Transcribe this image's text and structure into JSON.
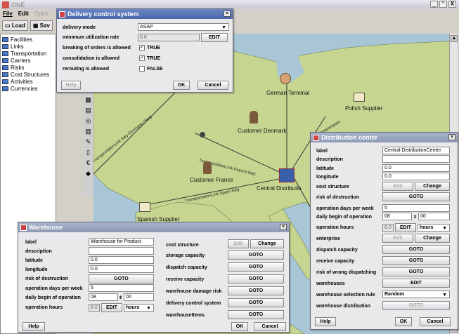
{
  "app": {
    "title": "ONE",
    "menu": [
      "File",
      "Edit",
      "Optio"
    ],
    "toolbar": {
      "load": "Load",
      "save": "Sav"
    },
    "window_controls": [
      "_",
      "°",
      "X"
    ]
  },
  "tree": {
    "items": [
      "Facilities",
      "Links",
      "Transportation",
      "Carriers",
      "Risks",
      "Cost Structures",
      "Activities",
      "Currencies"
    ]
  },
  "map": {
    "labels": {
      "german_terminal": "German Terminal",
      "polish_supplier": "Polish Supplier",
      "customer_denmark": "Customer Denmark",
      "customer_france": "Customer France",
      "central_distribution": "Central Distributio",
      "spanish_supplier": "Spanish Supplier"
    },
    "links": {
      "italy_germany": "TransportationLink Italy-Germany (Sea)",
      "france_italy": "TransportationLink France-Italy",
      "spain_italy": "TransportationLink Spain-Italy",
      "poland": "Transportation"
    }
  },
  "delivery_dialog": {
    "title": "Delivery control system",
    "rows": {
      "delivery_mode": {
        "label": "delivery mode",
        "value": "ASAP"
      },
      "min_util": {
        "label": "minimum utilization rate",
        "value": "0.0",
        "button": "EDIT"
      },
      "breaking": {
        "label": "breaking of orders is allowed",
        "value": "TRUE"
      },
      "consolidation": {
        "label": "consolidation is allowed",
        "value": "TRUE"
      },
      "rerouting": {
        "label": "rerouting is allowed",
        "value": "FALSE"
      }
    },
    "help": "Help",
    "ok": "OK",
    "cancel": "Cancel"
  },
  "warehouse_dialog": {
    "title": "Warehouse",
    "left": {
      "label": {
        "label": "label",
        "value": "Warehouse for Product"
      },
      "description": {
        "label": "description",
        "value": ""
      },
      "latitude": {
        "label": "latitude",
        "value": "0.0"
      },
      "longitude": {
        "label": "longitude",
        "value": "0.0"
      },
      "risk": {
        "label": "risk of destruction",
        "button": "GOTO"
      },
      "opdays": {
        "label": "operation days per week",
        "value": "5"
      },
      "daily_begin": {
        "label": "daily begin of operation",
        "hour": "08",
        "minute": "00"
      },
      "ophours": {
        "label": "operation hours",
        "value": "8.0",
        "button": "EDIT",
        "unit": "hours"
      }
    },
    "right": {
      "cost": {
        "label": "cost structure",
        "edit": "Edit",
        "change": "Change"
      },
      "storage": {
        "label": "storage capacity",
        "button": "GOTO"
      },
      "dispatch": {
        "label": "dispatch capacity",
        "button": "GOTO"
      },
      "receive": {
        "label": "receive capacity",
        "button": "GOTO"
      },
      "damage": {
        "label": "warehouse damage risk",
        "button": "GOTO"
      },
      "delivery": {
        "label": "delivery control system",
        "button": "GOTO"
      },
      "items": {
        "label": "warehouseItems",
        "button": "GOTO"
      }
    },
    "help": "Help",
    "ok": "OK",
    "cancel": "Cancel"
  },
  "dc_dialog": {
    "title": "Distribution center",
    "rows": {
      "label": {
        "label": "label",
        "value": "Central DistributionCenter"
      },
      "description": {
        "label": "description",
        "value": ""
      },
      "latitude": {
        "label": "latitude",
        "value": "0.0"
      },
      "longitude": {
        "label": "longitude",
        "value": "0.0"
      },
      "cost": {
        "label": "cost structure",
        "edit": "Edit",
        "change": "Change"
      },
      "risk": {
        "label": "risk of destruction",
        "button": "GOTO"
      },
      "opdays": {
        "label": "operation days per week",
        "value": "5"
      },
      "daily_begin": {
        "label": "daily begin of operation",
        "hour": "08",
        "minute": "00"
      },
      "ophours": {
        "label": "operation hours",
        "value": "8.0",
        "button": "EDIT",
        "unit": "hours"
      },
      "enterprise": {
        "label": "enterprise",
        "edit": "Edit",
        "change": "Change"
      },
      "dispatch": {
        "label": "dispatch capacity",
        "button": "GOTO"
      },
      "receive": {
        "label": "receive capacity",
        "button": "GOTO"
      },
      "wrong": {
        "label": "risk of wrong dispatching",
        "button": "GOTO"
      },
      "warehouses": {
        "label": "warehouses",
        "button": "EDIT"
      },
      "selection": {
        "label": "warehouse selection rule",
        "value": "Random"
      },
      "distribution": {
        "label": "warehouse distribution",
        "button": "GOTO"
      }
    },
    "help": "Help",
    "ok": "OK",
    "cancel": "Cancel"
  },
  "colors": {
    "sea": "#a9c6d7",
    "land": "#c6d690",
    "title_active": "#4c66a8",
    "title_inactive": "#8e9ab4"
  }
}
